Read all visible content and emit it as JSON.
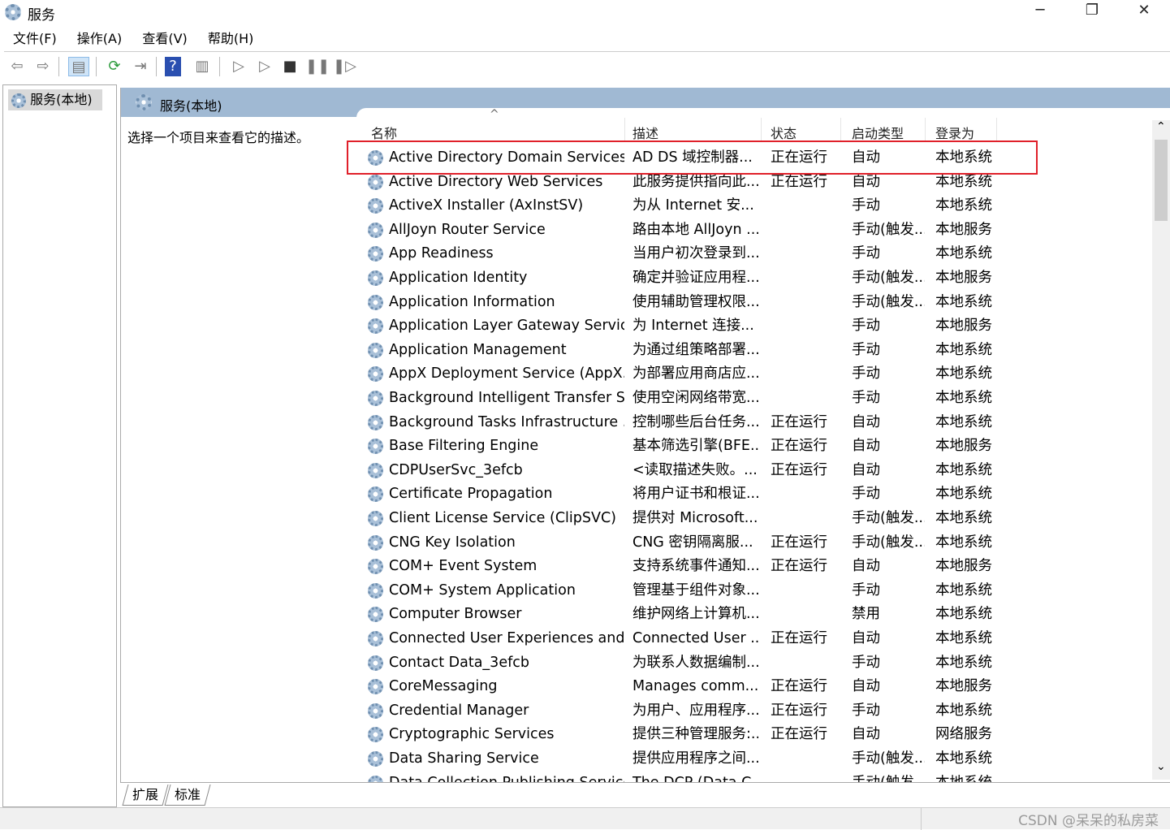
{
  "window": {
    "title": "服务",
    "minimize": "─",
    "restore": "❐",
    "close": "✕"
  },
  "menu": [
    "文件(F)",
    "操作(A)",
    "查看(V)",
    "帮助(H)"
  ],
  "toolbar": [
    {
      "icon": "back-arrow-icon",
      "glyph": "⇦"
    },
    {
      "icon": "forward-arrow-icon",
      "glyph": "⇨"
    },
    {
      "icon": "show-hide-console-tree-icon",
      "glyph": "▤"
    },
    {
      "icon": "refresh-icon",
      "glyph": "⟳"
    },
    {
      "icon": "export-list-icon",
      "glyph": "⇥"
    },
    {
      "icon": "help-icon",
      "glyph": "?"
    },
    {
      "icon": "show-action-pane-icon",
      "glyph": "▥"
    },
    {
      "icon": "start-service-icon",
      "glyph": "▷"
    },
    {
      "icon": "start-service-alt-icon",
      "glyph": "▷"
    },
    {
      "icon": "stop-service-icon",
      "glyph": "■"
    },
    {
      "icon": "pause-service-icon",
      "glyph": "❚❚"
    },
    {
      "icon": "resume-service-icon",
      "glyph": "❚▷"
    }
  ],
  "tree": {
    "item": "服务(本地)"
  },
  "panel": {
    "title": "服务(本地)",
    "description": "选择一个项目来查看它的描述。"
  },
  "columns": [
    "名称",
    "描述",
    "状态",
    "启动类型",
    "登录为"
  ],
  "sort_indicator": "^",
  "rows": [
    [
      "Active Directory Domain Services",
      "AD DS 域控制器...",
      "正在运行",
      "自动",
      "本地系统"
    ],
    [
      "Active Directory Web Services",
      "此服务提供指向此...",
      "正在运行",
      "自动",
      "本地系统"
    ],
    [
      "ActiveX Installer (AxInstSV)",
      "为从 Internet 安...",
      "",
      "手动",
      "本地系统"
    ],
    [
      "AllJoyn Router Service",
      "路由本地 AllJoyn ...",
      "",
      "手动(触发...",
      "本地服务"
    ],
    [
      "App Readiness",
      "当用户初次登录到...",
      "",
      "手动",
      "本地系统"
    ],
    [
      "Application Identity",
      "确定并验证应用程...",
      "",
      "手动(触发...",
      "本地服务"
    ],
    [
      "Application Information",
      "使用辅助管理权限...",
      "",
      "手动(触发...",
      "本地系统"
    ],
    [
      "Application Layer Gateway Service",
      "为 Internet 连接...",
      "",
      "手动",
      "本地服务"
    ],
    [
      "Application Management",
      "为通过组策略部署...",
      "",
      "手动",
      "本地系统"
    ],
    [
      "AppX Deployment Service (AppX...",
      "为部署应用商店应...",
      "",
      "手动",
      "本地系统"
    ],
    [
      "Background Intelligent Transfer S...",
      "使用空闲网络带宽...",
      "",
      "手动",
      "本地系统"
    ],
    [
      "Background Tasks Infrastructure ...",
      "控制哪些后台任务...",
      "正在运行",
      "自动",
      "本地系统"
    ],
    [
      "Base Filtering Engine",
      "基本筛选引擎(BFE...",
      "正在运行",
      "自动",
      "本地服务"
    ],
    [
      "CDPUserSvc_3efcb",
      "<读取描述失败。...",
      "正在运行",
      "自动",
      "本地系统"
    ],
    [
      "Certificate Propagation",
      "将用户证书和根证...",
      "",
      "手动",
      "本地系统"
    ],
    [
      "Client License Service (ClipSVC)",
      "提供对 Microsoft...",
      "",
      "手动(触发...",
      "本地系统"
    ],
    [
      "CNG Key Isolation",
      "CNG 密钥隔离服...",
      "正在运行",
      "手动(触发...",
      "本地系统"
    ],
    [
      "COM+ Event System",
      "支持系统事件通知...",
      "正在运行",
      "自动",
      "本地服务"
    ],
    [
      "COM+ System Application",
      "管理基于组件对象...",
      "",
      "手动",
      "本地系统"
    ],
    [
      "Computer Browser",
      "维护网络上计算机...",
      "",
      "禁用",
      "本地系统"
    ],
    [
      "Connected User Experiences and ...",
      "Connected User ...",
      "正在运行",
      "自动",
      "本地系统"
    ],
    [
      "Contact Data_3efcb",
      "为联系人数据编制...",
      "",
      "手动",
      "本地系统"
    ],
    [
      "CoreMessaging",
      "Manages comm...",
      "正在运行",
      "自动",
      "本地服务"
    ],
    [
      "Credential Manager",
      "为用户、应用程序...",
      "正在运行",
      "手动",
      "本地系统"
    ],
    [
      "Cryptographic Services",
      "提供三种管理服务:...",
      "正在运行",
      "自动",
      "网络服务"
    ],
    [
      "Data Sharing Service",
      "提供应用程序之间...",
      "",
      "手动(触发...",
      "本地系统"
    ],
    [
      "Data Collection Publishing Service",
      "The DCP (Data C...",
      "",
      "手动(触发...",
      "本地系统"
    ]
  ],
  "tabs": [
    "扩展",
    "标准"
  ],
  "scroll": {
    "up": "⌃",
    "down": "⌄"
  },
  "watermark": "CSDN @呆呆的私房菜",
  "colors": {
    "header_bar": "#a0b9d3",
    "highlight_box": "#e0202a"
  }
}
